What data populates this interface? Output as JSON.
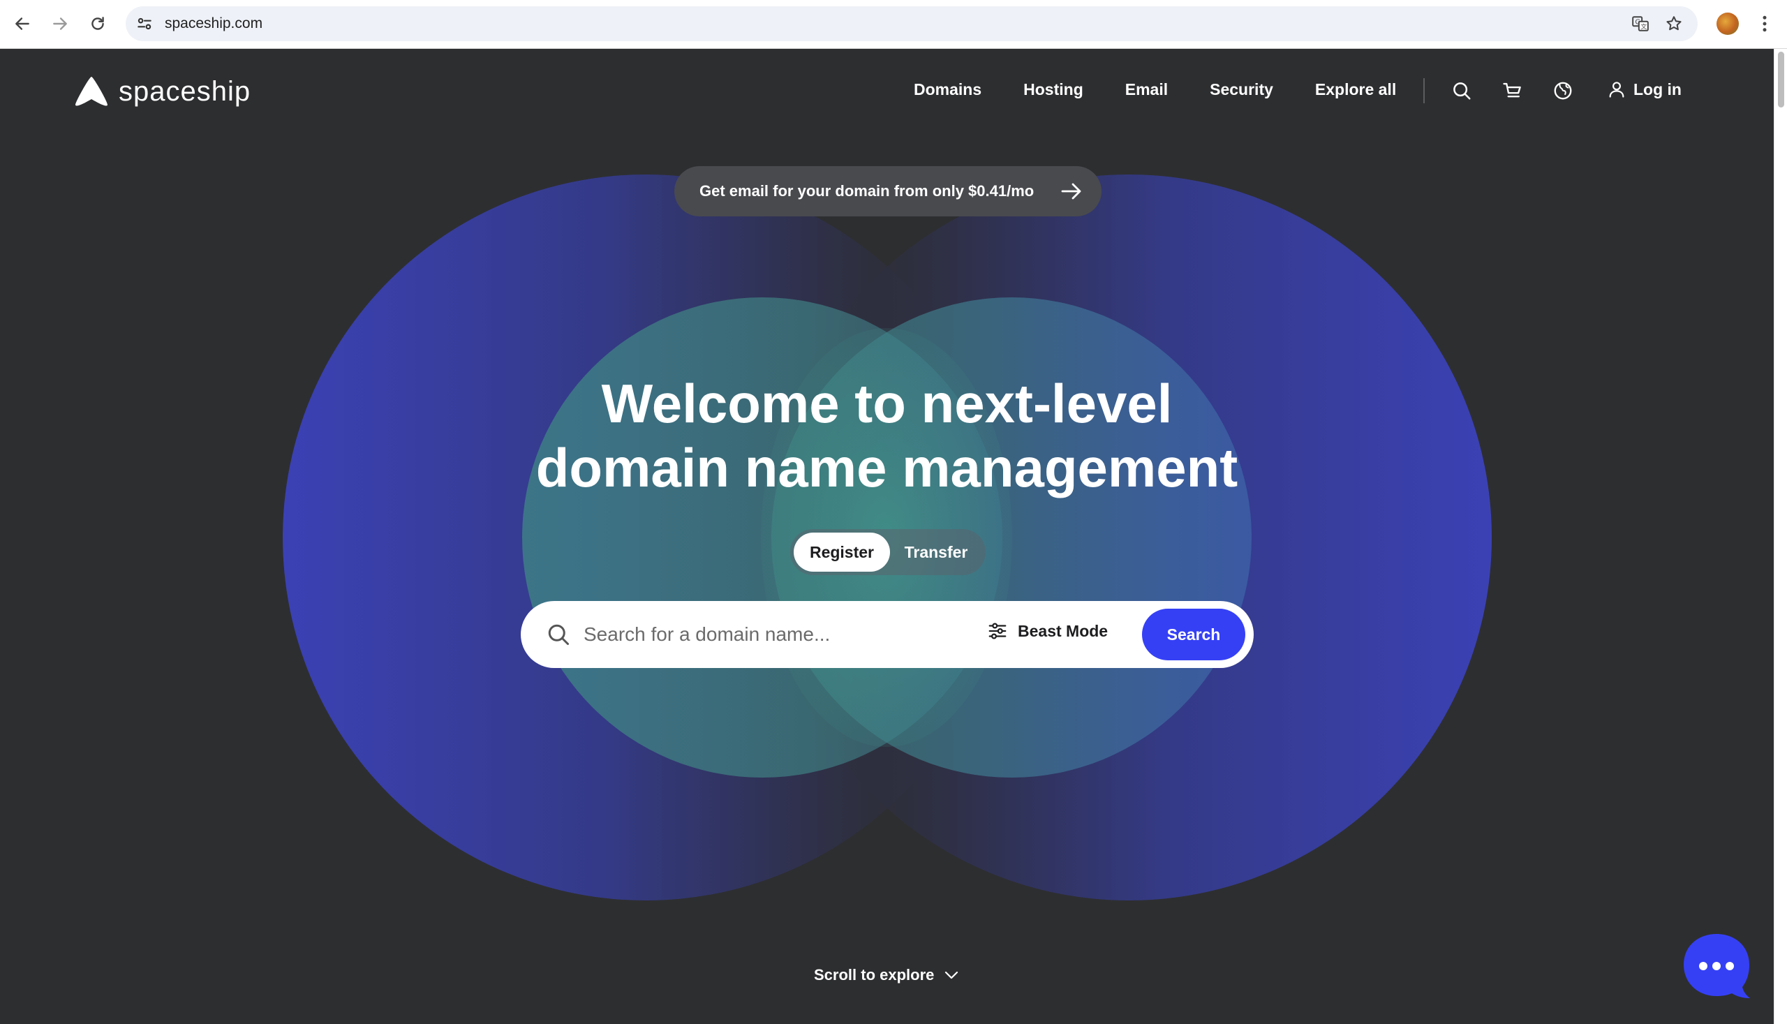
{
  "browser": {
    "url": "spaceship.com"
  },
  "header": {
    "brand": "spaceship",
    "nav": [
      "Domains",
      "Hosting",
      "Email",
      "Security",
      "Explore all"
    ],
    "login_label": "Log in"
  },
  "promo": {
    "text": "Get email for your domain from only $0.41/mo"
  },
  "hero": {
    "title_line1": "Welcome to next-level",
    "title_line2": "domain name management"
  },
  "mode_toggle": {
    "options": [
      "Register",
      "Transfer"
    ],
    "selected": "Register"
  },
  "search": {
    "placeholder": "Search for a domain name...",
    "value": "",
    "beast_mode_label": "Beast Mode",
    "button_label": "Search"
  },
  "footer_hint": {
    "scroll_label": "Scroll to explore"
  },
  "colors": {
    "page_bg": "#2d2e30",
    "accent": "#3540f5",
    "circle_blue": "#3a3fa8",
    "circle_teal": "#3f8a86"
  },
  "icons": {
    "back": "arrow-left-icon",
    "forward": "arrow-right-icon",
    "reload": "reload-icon",
    "site_info": "tune-icon",
    "translate": "translate-icon",
    "bookmark": "star-icon",
    "menu": "kebab-icon",
    "search": "search-icon",
    "cart": "cart-icon",
    "globe": "globe-icon",
    "user": "user-icon",
    "filters": "sliders-icon",
    "chevron": "chevron-down-icon",
    "chat": "chat-bubble-icon"
  }
}
